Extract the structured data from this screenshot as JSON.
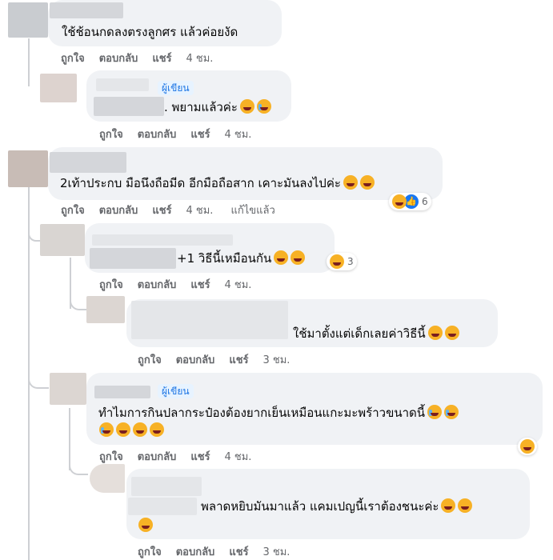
{
  "actions": {
    "like": "ถูกใจ",
    "reply": "ตอบกลับ",
    "share": "แชร์",
    "edited": "แก้ไขแล้ว"
  },
  "author_badge": "ผู้เขียน",
  "comments": [
    {
      "text": "ใช้ช้อนกดลงตรงลูกศร แล้วค่อยงัด",
      "time": "4 ชม."
    },
    {
      "text": ". พยามแล้วค่ะ",
      "time": "4 ชม."
    },
    {
      "text": "2เท้าประกบ มือนึงถือมีด อีกมือถือสาก เคาะมันลงไปค่ะ",
      "time": "4 ชม.",
      "reaction_count": "6"
    },
    {
      "text": "+1 วิธีนี้เหมือนกัน",
      "time": "4 ชม.",
      "reaction_count": "3"
    },
    {
      "text": "ใช้มาตั้งแต่เด็กเลยค่าวิธีนี้",
      "time": "3 ชม."
    },
    {
      "text": "ทำไมการกินปลากระป๋องต้องยากเย็นเหมือนแกะมะพร้าวขนาดนี้",
      "time": "4 ชม."
    },
    {
      "text": "พลาดหยิบมันมาแล้ว แคมเปญนี้เราต้องชนะค่ะ",
      "time": "3 ชม."
    }
  ],
  "icons": {
    "haha": "laughing-emoji-icon",
    "cry": "crying-emoji-icon",
    "like": "like-reaction-icon"
  },
  "colors": {
    "bubble": "#f0f2f5",
    "action_text": "#65676b",
    "badge_bg": "#e7f3ff",
    "badge_text": "#1b74e4",
    "like_blue": "#1877f2"
  }
}
